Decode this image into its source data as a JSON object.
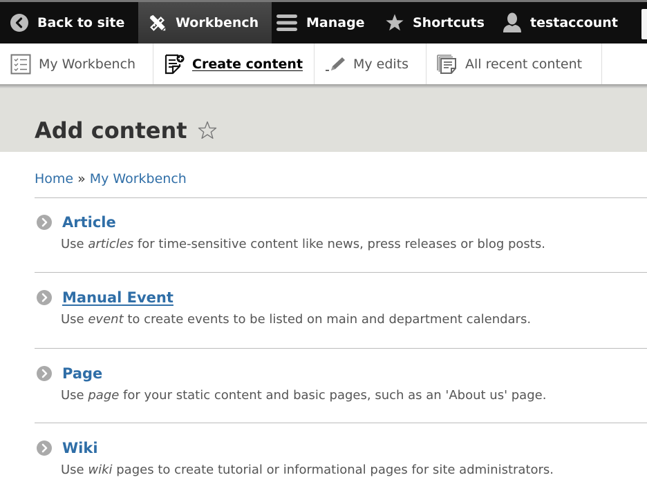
{
  "toolbar": {
    "back_to_site": "Back to site",
    "workbench": "Workbench",
    "manage": "Manage",
    "shortcuts": "Shortcuts",
    "user": "testaccount"
  },
  "tray": {
    "items": [
      {
        "label": "My Workbench",
        "icon": "checklist-icon"
      },
      {
        "label": "Create content",
        "icon": "create-content-icon",
        "active": true
      },
      {
        "label": "My edits",
        "icon": "pencil-icon"
      },
      {
        "label": "All recent content",
        "icon": "documents-stack-icon"
      }
    ]
  },
  "page": {
    "title": "Add content",
    "shortcut_icon": "star-outline-icon"
  },
  "breadcrumb": {
    "items": [
      "Home",
      "My Workbench"
    ],
    "separator": "»"
  },
  "content_types": [
    {
      "title": "Article",
      "desc_pre": "Use ",
      "desc_em": "articles",
      "desc_post": " for time-sensitive content like news, press releases or blog posts."
    },
    {
      "title": "Manual Event",
      "desc_pre": "Use ",
      "desc_em": "event",
      "desc_post": " to create events to be listed on main and department calendars."
    },
    {
      "title": "Page",
      "desc_pre": "Use ",
      "desc_em": "page",
      "desc_post": " for your static content and basic pages, such as an 'About us' page."
    },
    {
      "title": "Wiki",
      "desc_pre": "Use ",
      "desc_em": "wiki",
      "desc_post": " pages to create tutorial or informational pages for site administrators."
    }
  ],
  "colors": {
    "link": "#2f6ea7",
    "toolbar_bg": "#0f0f0f",
    "header_bg": "#e0e0db"
  }
}
